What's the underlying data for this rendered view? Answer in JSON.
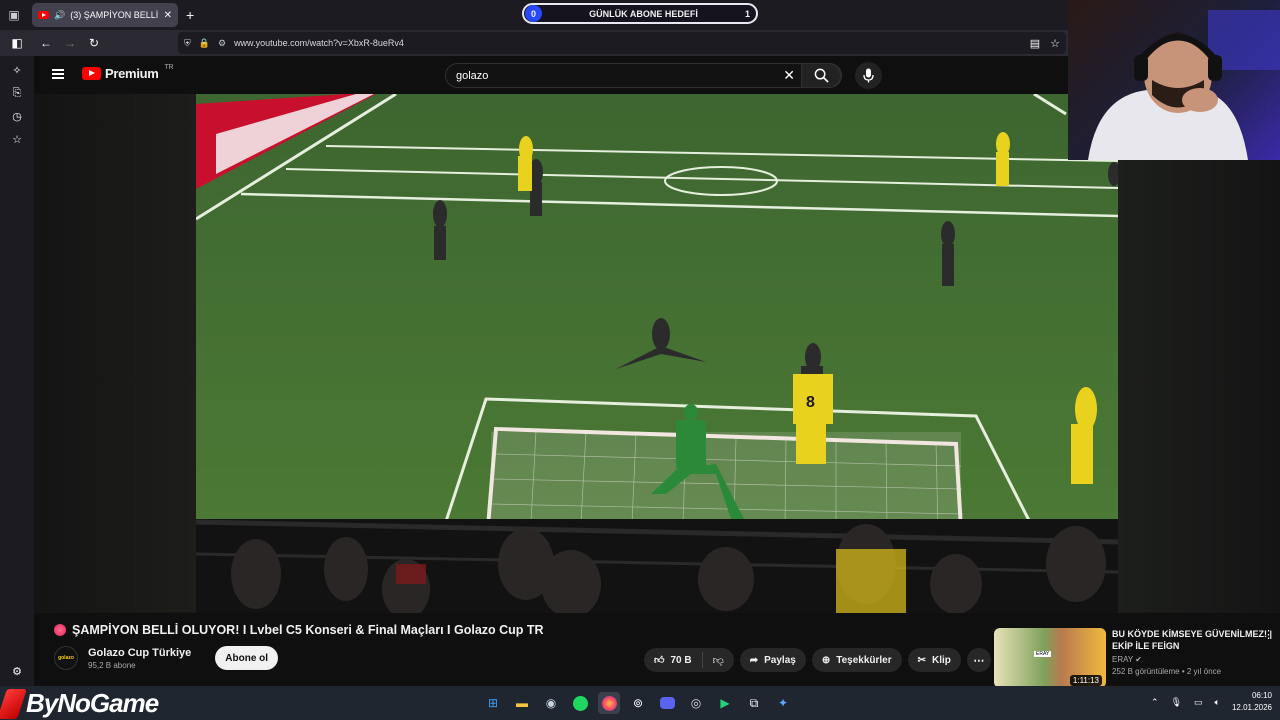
{
  "browser": {
    "tab": {
      "count_badge": "(3)",
      "title": "ŞAMPİYON BELLİ OLUYOR",
      "close": "✕"
    },
    "new_tab": "+",
    "url": "www.youtube.com/watch?v=XbxR-8ueRv4"
  },
  "overlay_goal": {
    "start": "0",
    "label": "GÜNLÜK ABONE HEDEFİ",
    "end": "1"
  },
  "youtube": {
    "logo_text": "Premium",
    "logo_region": "TR",
    "search_value": "golazo",
    "clear_icon": "✕"
  },
  "video": {
    "title": "ŞAMPİYON BELLİ OLUYOR! I Lvbel C5 Konseri & Final Maçları I Golazo Cup TR",
    "channel_name": "Golazo Cup Türkiye",
    "channel_avatar": "golazo",
    "subscribers": "95,2 B abone",
    "subscribe_label": "Abone ol",
    "likes": "70 B",
    "share_label": "Paylaş",
    "thanks_label": "Teşekkürler",
    "clip_label": "Klip",
    "jersey_number": "8"
  },
  "recommendation": {
    "title": "BU KÖYDE KİMSEYE GÜVENİLMEZ! | EKİP İLE FEİGN",
    "channel": "ERAY",
    "meta": "252 B görüntüleme • 2 yıl önce",
    "duration": "1:11:13",
    "thumb_tag": "ERAY"
  },
  "taskbar": {
    "brand": "ByNoGame",
    "time": "06:10",
    "date": "12.01.2026"
  },
  "colors": {
    "accent_red": "#ff0000",
    "goal_bubble": "#2848ff",
    "pitch": "#3f6a2e"
  }
}
